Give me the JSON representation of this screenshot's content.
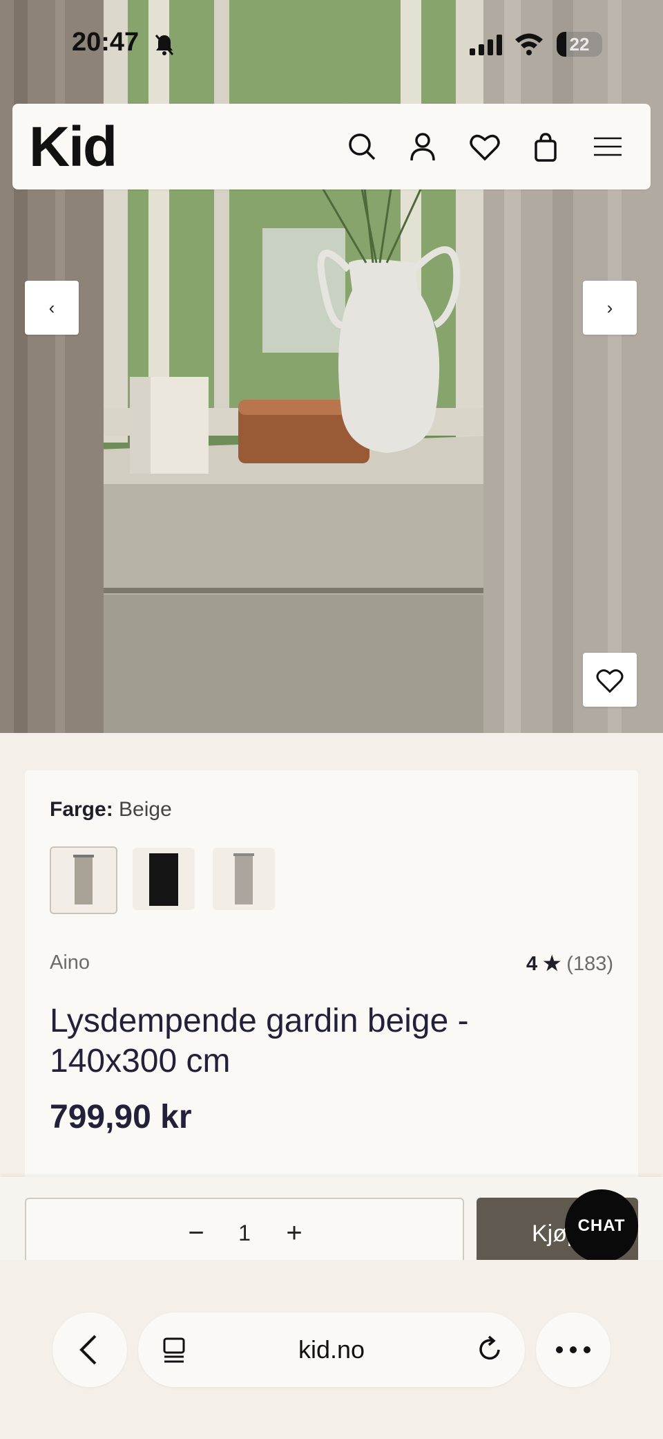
{
  "status": {
    "time": "20:47",
    "battery": "22"
  },
  "header": {
    "logo": "Kid"
  },
  "slider": {
    "prev": "‹",
    "next": "›"
  },
  "product": {
    "color_label": "Farge:",
    "color_value": "Beige",
    "brand": "Aino",
    "rating_value": "4",
    "rating_star": "★",
    "rating_count": "(183)",
    "title": "Lysdempende gardin beige - 140x300 cm",
    "price": "799,90 kr"
  },
  "purchase": {
    "minus": "−",
    "quantity": "1",
    "plus": "+",
    "buy_label": "Kjøp"
  },
  "chat": {
    "label": "CHAT"
  },
  "browser": {
    "url": "kid.no"
  }
}
